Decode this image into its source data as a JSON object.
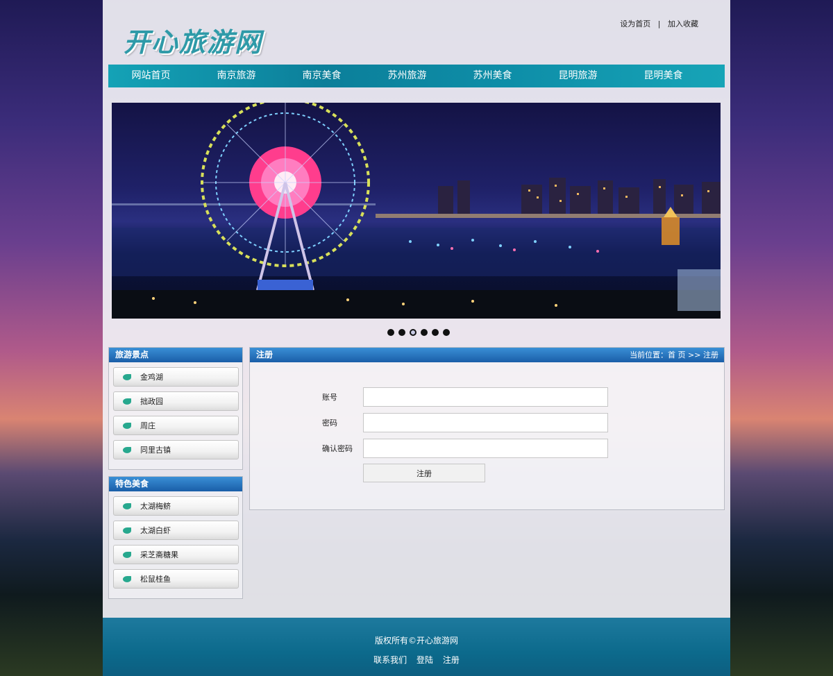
{
  "header": {
    "logo_text": "开心旅游网",
    "set_home": "设为首页",
    "separator": "|",
    "add_favorite": "加入收藏"
  },
  "nav": {
    "items": [
      "网站首页",
      "南京旅游",
      "南京美食",
      "苏州旅游",
      "苏州美食",
      "昆明旅游",
      "昆明美食"
    ]
  },
  "carousel": {
    "dot_count": 6,
    "active_index": 2
  },
  "sidebar": {
    "sections": [
      {
        "title": "旅游景点",
        "items": [
          "金鸡湖",
          "拙政园",
          "周庄",
          "同里古镇"
        ]
      },
      {
        "title": "特色美食",
        "items": [
          "太湖梅鲚",
          "太湖白虾",
          "采芝斋糖果",
          "松鼠桂鱼"
        ]
      }
    ]
  },
  "register": {
    "title": "注册",
    "breadcrumb": "当前位置：首 页 >> 注册",
    "account_label": "账号",
    "password_label": "密码",
    "confirm_label": "确认密码",
    "submit_label": "注册"
  },
  "footer": {
    "copyright": "版权所有©开心旅游网",
    "links": [
      "联系我们",
      "登陆",
      "注册"
    ]
  },
  "colors": {
    "nav_bg": "#0c7f9a",
    "box_title": "#1a5ea8",
    "footer_bg": "#0c6a8c",
    "logo": "#2e9aa8",
    "leaf": "#27a88e"
  }
}
